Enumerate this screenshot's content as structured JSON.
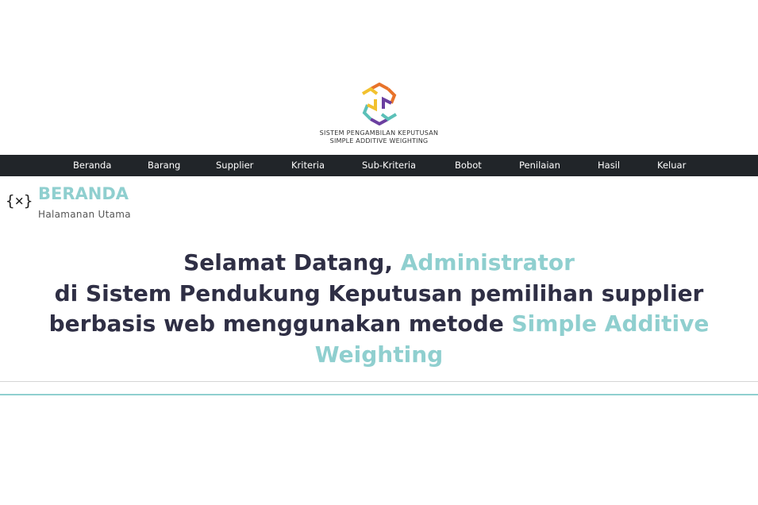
{
  "logo": {
    "title": "SISTEM PENGAMBILAN KEPUTUSAN",
    "subtitle": "SIMPLE ADDITIVE WEIGHTING",
    "colors": [
      "#f2c12e",
      "#e8732a",
      "#5bc0b8",
      "#6b3fa0"
    ]
  },
  "nav": {
    "items": [
      {
        "label": "Beranda"
      },
      {
        "label": "Barang"
      },
      {
        "label": "Supplier"
      },
      {
        "label": "Kriteria"
      },
      {
        "label": "Sub-Kriteria"
      },
      {
        "label": "Bobot"
      },
      {
        "label": "Penilaian"
      },
      {
        "label": "Hasil"
      },
      {
        "label": "Keluar"
      }
    ]
  },
  "page": {
    "icon": "variable-icon",
    "icon_text": "{×}",
    "title": "BERANDA",
    "subtitle": "Halamanan Utama"
  },
  "welcome": {
    "greeting": "Selamat Datang, ",
    "user": "Administrator",
    "line2": "di Sistem Pendukung Keputusan pemilihan supplier",
    "line3": "berbasis web menggunakan metode ",
    "method": "Simple Additive Weighting"
  },
  "colors": {
    "accent": "#8fcfcf",
    "navbar": "#212529",
    "text": "#2f2f45"
  }
}
